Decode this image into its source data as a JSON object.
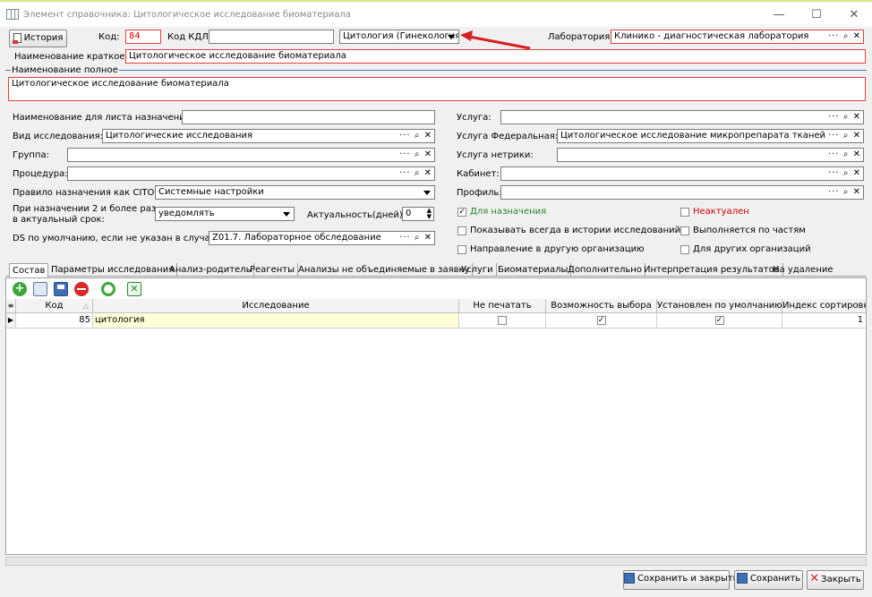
{
  "window": {
    "title": "Элемент справочника: Цитологическое исследование биоматериала",
    "min": "—",
    "max": "☐",
    "close": "✕"
  },
  "header": {
    "history_button": "История",
    "code_label": "Код:",
    "code_value": "84",
    "kdl_label": "Код КДЛ:",
    "kdl_value": "",
    "type_select": "Цитология (Гинекология)",
    "lab_label": "Лаборатория:",
    "lab_value": "Клинико - диагностическая лаборатория",
    "short_name_label": "Наименование краткое:",
    "short_name_value": "Цитологическое исследование биоматериала",
    "full_name_label": "Наименование полное",
    "full_name_value": "Цитологическое исследование биоматериала"
  },
  "left": {
    "assign_name_label": "Наименование для листа назначений:",
    "assign_name_value": "",
    "study_type_label": "Вид исследования:",
    "study_type_value": "Цитологические исследования",
    "group_label": "Группа:",
    "group_value": "",
    "procedure_label": "Процедура:",
    "procedure_value": "",
    "cito_label": "Правило назначения как CITO:",
    "cito_value": "Системные настройки",
    "repeat_label_1": "При назначении 2 и более раз",
    "repeat_label_2": "в актуальный срок:",
    "repeat_value": "уведомлять",
    "actuality_label": "Актуальность(дней):",
    "actuality_value": "0",
    "ds_label": "DS по умолчанию, если не указан в случае:",
    "ds_value": "Z01.7. Лабораторное обследование"
  },
  "right": {
    "service_label": "Услуга:",
    "service_value": "",
    "fed_service_label": "Услуга Федеральная:",
    "fed_service_value": "Цитологическое исследование микропрепарата тканей матки",
    "metric_service_label": "Услуга нетрики:",
    "metric_service_value": "",
    "cabinet_label": "Кабинет:",
    "cabinet_value": "",
    "profile_label": "Профиль:",
    "profile_value": ""
  },
  "checks": {
    "for_assign": "Для назначения",
    "not_actual": "Неактуален",
    "show_history": "Показывать всегда в истории исследований",
    "by_parts": "Выполняется по частям",
    "other_org_direction": "Направление в другую организацию",
    "for_other_orgs": "Для других организаций"
  },
  "tool_glyphs": {
    "more": "···",
    "search": "🔍",
    "clear": "✕"
  },
  "tabs": [
    "Состав",
    "Параметры исследования",
    "Анализ-родитель",
    "Реагенты",
    "Анализы не объединяемые в заявку",
    "Услуги",
    "Биоматериалы",
    "Дополнительно",
    "Интерпретация результатов",
    "На удаление"
  ],
  "grid": {
    "columns": [
      "Код",
      "Исследование",
      "Не печатать",
      "Возможность выбора",
      "Установлен по умолчанию",
      "Индекс сортировки"
    ],
    "rows": [
      {
        "code": "85",
        "name": "цитология",
        "no_print": false,
        "selectable": true,
        "default": true,
        "sort": "1"
      }
    ]
  },
  "footer": {
    "save_close": "Сохранить и закрыть",
    "save": "Сохранить",
    "close": "Закрыть"
  },
  "colors": {
    "required_border": "#e04040",
    "green_text": "#228b22",
    "red_text": "#cc0000",
    "highlight": "#ffffd8",
    "arrow": "#d42020"
  }
}
